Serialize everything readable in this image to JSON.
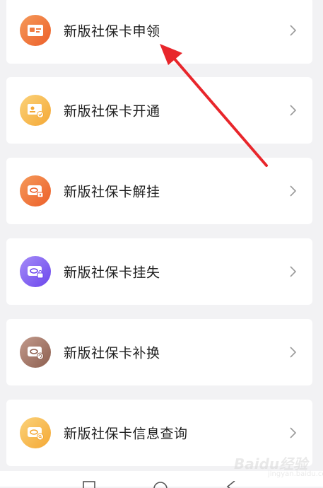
{
  "menu": {
    "items": [
      {
        "label": "新版社保卡申领",
        "icon": "id-card-icon",
        "color": "#f0702e"
      },
      {
        "label": "新版社保卡开通",
        "icon": "id-card-check-icon",
        "color": "#f7b83c"
      },
      {
        "label": "新版社保卡解挂",
        "icon": "card-unlock-icon",
        "color": "#f0702e"
      },
      {
        "label": "新版社保卡挂失",
        "icon": "card-lock-icon",
        "color": "#7b5cf0"
      },
      {
        "label": "新版社保卡补换",
        "icon": "card-replace-icon",
        "color": "#9c6c5c"
      },
      {
        "label": "新版社保卡信息查询",
        "icon": "card-search-icon",
        "color": "#f7b83c"
      }
    ]
  },
  "watermark": {
    "text": "Baidu经验",
    "sub": "jingyan.baidu.com"
  },
  "annotation": {
    "arrow_color": "#e8262b"
  },
  "system_nav": {
    "buttons": [
      "recent-apps-icon",
      "home-icon",
      "back-icon"
    ]
  }
}
